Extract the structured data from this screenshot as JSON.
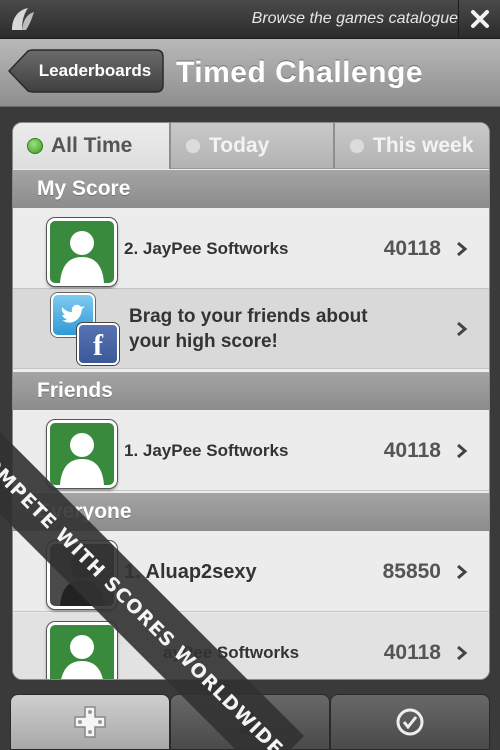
{
  "top_bar": {
    "browse_label": "Browse the games catalogue",
    "logo_icon": "leaf-logo-icon",
    "close_icon": "close-x-icon"
  },
  "header": {
    "back_label": "Leaderboards",
    "title": "Timed Challenge"
  },
  "tabs": [
    {
      "label": "All Time",
      "active": true
    },
    {
      "label": "Today",
      "active": false
    },
    {
      "label": "This week",
      "active": false
    }
  ],
  "sections": {
    "my_score": "My Score",
    "friends": "Friends",
    "everyone": "Everyone"
  },
  "my_score_row": {
    "rank_name": "2. JayPee Softworks",
    "score": "40118"
  },
  "brag": {
    "line1": "Brag to your friends about",
    "line2": "your high score!",
    "icons": [
      "twitter-icon",
      "facebook-icon"
    ]
  },
  "friends_row": {
    "rank_name": "1. JayPee Softworks",
    "score": "40118"
  },
  "everyone_rows": [
    {
      "rank_name": "1. Aluap2sexy",
      "score": "85850"
    },
    {
      "rank_name": "ayPee Softworks",
      "score": "40118"
    }
  ],
  "ribbon_text": "COMPETE WITH SCORES WORLDWIDE",
  "toolbar_icons": [
    "gamepad-icon",
    "profile-icon",
    "checkmark-icon"
  ],
  "colors": {
    "accent_green": "#3a8a3e",
    "header_gray": "#a0a0a0"
  }
}
